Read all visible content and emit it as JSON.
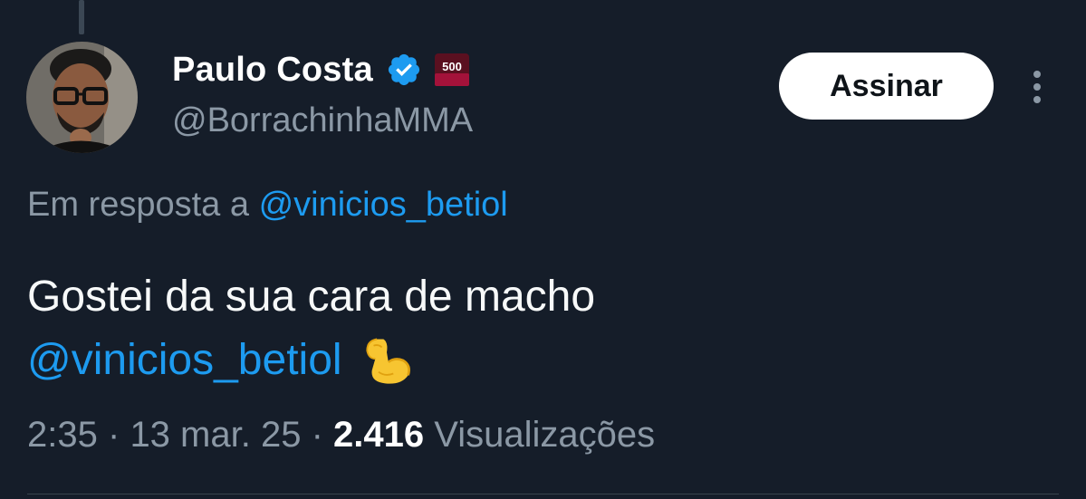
{
  "author": {
    "display_name": "Paulo Costa",
    "handle": "@BorrachinhaMMA",
    "verified_icon": "verified-badge-icon",
    "affiliate_badge_text": "500"
  },
  "actions": {
    "subscribe_label": "Assinar",
    "more_icon": "more-vertical-icon"
  },
  "reply": {
    "prefix": "Em resposta a",
    "mention": "@vinicios_betiol"
  },
  "tweet": {
    "text_line1": "Gostei da sua cara de macho",
    "mention": "@vinicios_betiol",
    "emoji": "💪"
  },
  "meta": {
    "time": "2:35",
    "separator": "·",
    "date": "13 mar. 25",
    "views_count": "2.416",
    "views_label": "Visualizações"
  },
  "colors": {
    "background": "#151d29",
    "link": "#1d9bf0",
    "muted": "#8b98a5",
    "text": "#f7f9f9"
  }
}
